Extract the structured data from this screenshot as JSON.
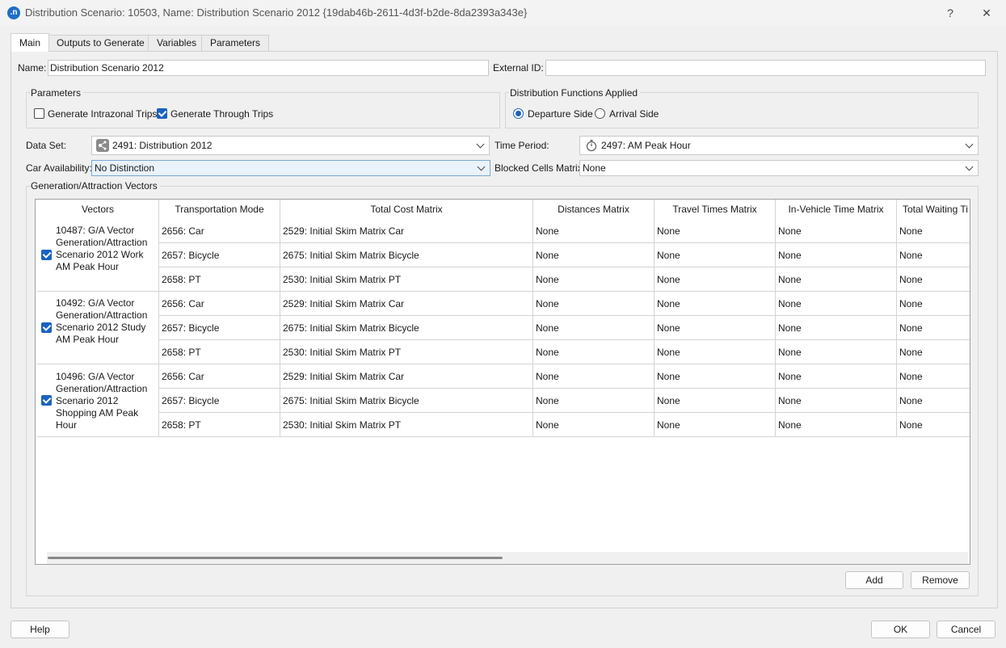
{
  "window": {
    "app_icon_letter": ".n",
    "title": "Distribution Scenario: 10503, Name: Distribution Scenario 2012  {19dab46b-2611-4d3f-b2de-8da2393a343e}",
    "help_glyph": "?",
    "close_glyph": "✕"
  },
  "tabs": [
    {
      "label": "Main"
    },
    {
      "label": "Outputs to Generate"
    },
    {
      "label": "Variables"
    },
    {
      "label": "Parameters"
    }
  ],
  "main": {
    "name_label": "Name:",
    "name_value": "Distribution Scenario 2012",
    "external_id_label": "External ID:",
    "external_id_value": "",
    "parameters_group": {
      "title": "Parameters",
      "intrazonal_label": "Generate Intrazonal Trips",
      "intrazonal_checked": false,
      "through_label": "Generate Through Trips",
      "through_checked": true
    },
    "distribution_group": {
      "title": "Distribution Functions Applied",
      "departure_label": "Departure Side",
      "arrival_label": "Arrival Side",
      "selected": "Departure Side"
    },
    "data_set_label": "Data Set:",
    "data_set_value": "2491: Distribution 2012",
    "time_period_label": "Time Period:",
    "time_period_value": "2497: AM Peak Hour",
    "car_availability_label": "Car Availability:",
    "car_availability_value": "No Distinction",
    "blocked_cells_label": "Blocked Cells Matrix:",
    "blocked_cells_value": "None",
    "ga_group_title": "Generation/Attraction Vectors",
    "grid": {
      "columns": [
        "Vectors",
        "Transportation Mode",
        "Total Cost Matrix",
        "Distances Matrix",
        "Travel Times Matrix",
        "In-Vehicle Time Matrix",
        "Total Waiting Ti"
      ],
      "vectors": [
        {
          "label": "10487: G/A Vector Generation/Attraction Scenario 2012 Work AM Peak Hour",
          "checked": true,
          "rows": [
            [
              "2656: Car",
              "2529: Initial Skim Matrix Car",
              "None",
              "None",
              "None",
              "None"
            ],
            [
              "2657: Bicycle",
              "2675: Initial Skim Matrix Bicycle",
              "None",
              "None",
              "None",
              "None"
            ],
            [
              "2658: PT",
              "2530: Initial Skim Matrix PT",
              "None",
              "None",
              "None",
              "None"
            ]
          ]
        },
        {
          "label": "10492: G/A Vector Generation/Attraction Scenario 2012 Study AM Peak Hour",
          "checked": true,
          "rows": [
            [
              "2656: Car",
              "2529: Initial Skim Matrix Car",
              "None",
              "None",
              "None",
              "None"
            ],
            [
              "2657: Bicycle",
              "2675: Initial Skim Matrix Bicycle",
              "None",
              "None",
              "None",
              "None"
            ],
            [
              "2658: PT",
              "2530: Initial Skim Matrix PT",
              "None",
              "None",
              "None",
              "None"
            ]
          ]
        },
        {
          "label": "10496: G/A Vector Generation/Attraction Scenario 2012 Shopping AM Peak Hour",
          "checked": true,
          "rows": [
            [
              "2656: Car",
              "2529: Initial Skim Matrix Car",
              "None",
              "None",
              "None",
              "None"
            ],
            [
              "2657: Bicycle",
              "2675: Initial Skim Matrix Bicycle",
              "None",
              "None",
              "None",
              "None"
            ],
            [
              "2658: PT",
              "2530: Initial Skim Matrix PT",
              "None",
              "None",
              "None",
              "None"
            ]
          ]
        }
      ]
    },
    "add_label": "Add",
    "remove_label": "Remove"
  },
  "footer": {
    "help_label": "Help",
    "ok_label": "OK",
    "cancel_label": "Cancel"
  },
  "colors": {
    "accent": "#1a62c0",
    "background": "#f0f0f0"
  }
}
